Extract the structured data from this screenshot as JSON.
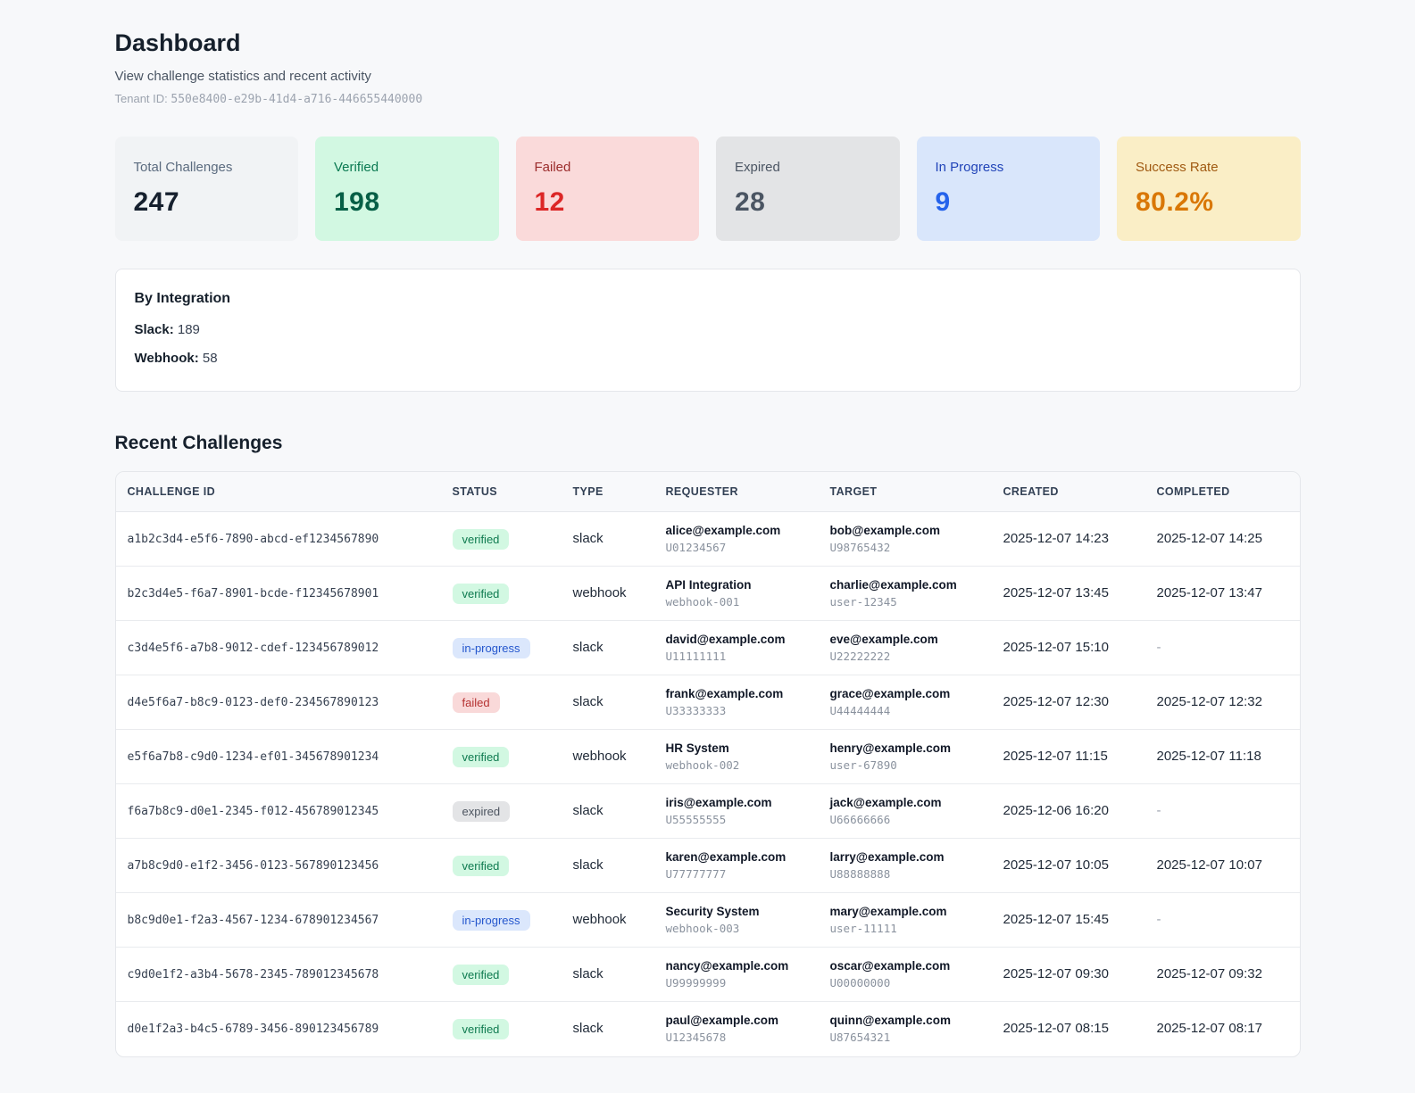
{
  "page": {
    "title": "Dashboard",
    "subtitle": "View challenge statistics and recent activity",
    "tenant_label": "Tenant ID:",
    "tenant_id": "550e8400-e29b-41d4-a716-446655440000"
  },
  "stats": [
    {
      "label": "Total Challenges",
      "value": "247",
      "bg": "#f1f3f5",
      "label_color": "#5b6b7f",
      "value_color": "#16202e"
    },
    {
      "label": "Verified",
      "value": "198",
      "bg": "#d2f8e2",
      "label_color": "#0b7a52",
      "value_color": "#065f46"
    },
    {
      "label": "Failed",
      "value": "12",
      "bg": "#fadada",
      "label_color": "#9b2c2c",
      "value_color": "#dc2626"
    },
    {
      "label": "Expired",
      "value": "28",
      "bg": "#e3e4e6",
      "label_color": "#4b5563",
      "value_color": "#4b5563"
    },
    {
      "label": "In Progress",
      "value": "9",
      "bg": "#d9e6fb",
      "label_color": "#2144b8",
      "value_color": "#2563eb"
    },
    {
      "label": "Success Rate",
      "value": "80.2%",
      "bg": "#faeec6",
      "label_color": "#a05a12",
      "value_color": "#d97706"
    }
  ],
  "by_integration": {
    "title": "By Integration",
    "items": [
      {
        "label": "Slack:",
        "value": "189"
      },
      {
        "label": "Webhook:",
        "value": "58"
      }
    ]
  },
  "recent": {
    "title": "Recent Challenges",
    "columns": [
      "Challenge ID",
      "Status",
      "Type",
      "Requester",
      "Target",
      "Created",
      "Completed"
    ],
    "status_colors": {
      "verified": {
        "bg": "#d2f8e2",
        "text": "#0e7a4f"
      },
      "in-progress": {
        "bg": "#dbe7fc",
        "text": "#2456cd"
      },
      "failed": {
        "bg": "#f9d9d9",
        "text": "#b53232"
      },
      "expired": {
        "bg": "#e3e4e6",
        "text": "#4d5560"
      }
    },
    "rows": [
      {
        "id": "a1b2c3d4-e5f6-7890-abcd-ef1234567890",
        "status": "verified",
        "type": "slack",
        "requester_name": "alice@example.com",
        "requester_id": "U01234567",
        "target_name": "bob@example.com",
        "target_id": "U98765432",
        "created": "2025-12-07 14:23",
        "completed": "2025-12-07 14:25"
      },
      {
        "id": "b2c3d4e5-f6a7-8901-bcde-f12345678901",
        "status": "verified",
        "type": "webhook",
        "requester_name": "API Integration",
        "requester_id": "webhook-001",
        "target_name": "charlie@example.com",
        "target_id": "user-12345",
        "created": "2025-12-07 13:45",
        "completed": "2025-12-07 13:47"
      },
      {
        "id": "c3d4e5f6-a7b8-9012-cdef-123456789012",
        "status": "in-progress",
        "type": "slack",
        "requester_name": "david@example.com",
        "requester_id": "U11111111",
        "target_name": "eve@example.com",
        "target_id": "U22222222",
        "created": "2025-12-07 15:10",
        "completed": "-"
      },
      {
        "id": "d4e5f6a7-b8c9-0123-def0-234567890123",
        "status": "failed",
        "type": "slack",
        "requester_name": "frank@example.com",
        "requester_id": "U33333333",
        "target_name": "grace@example.com",
        "target_id": "U44444444",
        "created": "2025-12-07 12:30",
        "completed": "2025-12-07 12:32"
      },
      {
        "id": "e5f6a7b8-c9d0-1234-ef01-345678901234",
        "status": "verified",
        "type": "webhook",
        "requester_name": "HR System",
        "requester_id": "webhook-002",
        "target_name": "henry@example.com",
        "target_id": "user-67890",
        "created": "2025-12-07 11:15",
        "completed": "2025-12-07 11:18"
      },
      {
        "id": "f6a7b8c9-d0e1-2345-f012-456789012345",
        "status": "expired",
        "type": "slack",
        "requester_name": "iris@example.com",
        "requester_id": "U55555555",
        "target_name": "jack@example.com",
        "target_id": "U66666666",
        "created": "2025-12-06 16:20",
        "completed": "-"
      },
      {
        "id": "a7b8c9d0-e1f2-3456-0123-567890123456",
        "status": "verified",
        "type": "slack",
        "requester_name": "karen@example.com",
        "requester_id": "U77777777",
        "target_name": "larry@example.com",
        "target_id": "U88888888",
        "created": "2025-12-07 10:05",
        "completed": "2025-12-07 10:07"
      },
      {
        "id": "b8c9d0e1-f2a3-4567-1234-678901234567",
        "status": "in-progress",
        "type": "webhook",
        "requester_name": "Security System",
        "requester_id": "webhook-003",
        "target_name": "mary@example.com",
        "target_id": "user-11111",
        "created": "2025-12-07 15:45",
        "completed": "-"
      },
      {
        "id": "c9d0e1f2-a3b4-5678-2345-789012345678",
        "status": "verified",
        "type": "slack",
        "requester_name": "nancy@example.com",
        "requester_id": "U99999999",
        "target_name": "oscar@example.com",
        "target_id": "U00000000",
        "created": "2025-12-07 09:30",
        "completed": "2025-12-07 09:32"
      },
      {
        "id": "d0e1f2a3-b4c5-6789-3456-890123456789",
        "status": "verified",
        "type": "slack",
        "requester_name": "paul@example.com",
        "requester_id": "U12345678",
        "target_name": "quinn@example.com",
        "target_id": "U87654321",
        "created": "2025-12-07 08:15",
        "completed": "2025-12-07 08:17"
      }
    ]
  }
}
